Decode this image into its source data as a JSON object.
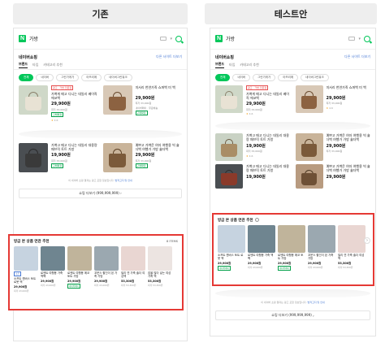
{
  "panels": {
    "left_title": "기존",
    "right_title": "테스트안"
  },
  "header": {
    "query": "가방",
    "logo": "N"
  },
  "shopping": {
    "title": "네이버쇼핑",
    "more_link": "다른 사이트 더보기",
    "subtabs": [
      "브랜드",
      "타입",
      "카테고리 추천"
    ],
    "chips": [
      "전체",
      "네이버",
      "그린가게가",
      "아뜨리에",
      "네이버그린워크"
    ],
    "products": [
      {
        "tag": "광고 · 가방 전문점",
        "name": "가벼게 매고 다니는 데일리 베이직 에코백",
        "price": "29,900원",
        "compare": "최저 33,000원",
        "meta": "네이버페이 · 무료배송",
        "badge": "구매확정",
        "rating": "4.6"
      },
      {
        "tag": "",
        "name": "미서리 천연가죽 쇼퍼백 미 백",
        "price": "29,900원",
        "compare": "최저 33,000원",
        "meta": "네이버페이 · 무료배송",
        "badge": "구매확정",
        "rating": "4.6"
      },
      {
        "tag": "",
        "name": "가벼고 매고 다니는 데일리 대용량 패브릭 토트 가방",
        "price": "19,900원",
        "compare": "최저 33,000원",
        "meta": "네이버페이 · 무료배송",
        "badge": "구매확정",
        "rating": "4.6"
      },
      {
        "tag": "",
        "name": "예쁘고 가벼운 여자 여행용 빅 숄더백 여행가 가방 숄더백",
        "price": "29,900원",
        "compare": "최저 33,000원",
        "meta": "네이버페이 · 무료배송",
        "badge": "구매확정",
        "rating": "4.6"
      }
    ],
    "notice_pre": "이 네이버 쇼핑 결과는 광고 포함 정보입니다.",
    "notice_link": "법적고지 및 안내",
    "shop_more": "쇼핑 더보기 (999,999,999)"
  },
  "reco": {
    "title": "방금 본 상품 연관 추천",
    "count": "8 ITEMS",
    "items": [
      {
        "tag": "쿠폰",
        "name": "소프트 캔버스 토트 로봇 백",
        "price": "29,900원",
        "compare": "최저 43,000원",
        "meta": "스토어팜",
        "badge": "네이버페이"
      },
      {
        "tag": "",
        "name": "로엔트 여행용 가죽 백팩",
        "price": "29,900원",
        "compare": "최저 43,000원",
        "meta": "스토어팜",
        "badge": ""
      },
      {
        "tag": "",
        "name": "로엔트 여행용 에코 토트 가방",
        "price": "29,900원",
        "compare": "최저 43,000원",
        "meta": "스토어팜",
        "badge": "네이버페이"
      },
      {
        "tag": "",
        "name": "꼬운스 할인이 된 가죽 가방",
        "price": "29,900원",
        "compare": "최저 43,000원",
        "meta": "스토어팜",
        "badge": ""
      },
      {
        "tag": "",
        "name": "빌리 연 가죽 숄더 여성백",
        "price": "53,300원",
        "compare": "최저 53,300원",
        "meta": "스토어팜",
        "badge": ""
      },
      {
        "tag": "",
        "name": "집을 많이 넣는 여성 가죽 백",
        "price": "53,300원",
        "compare": "최저 53,300원",
        "meta": "스토어팜",
        "badge": ""
      }
    ]
  },
  "colors": {
    "brand": "#03c75a",
    "highlight": "#e53935",
    "link": "#4a7bd4"
  }
}
